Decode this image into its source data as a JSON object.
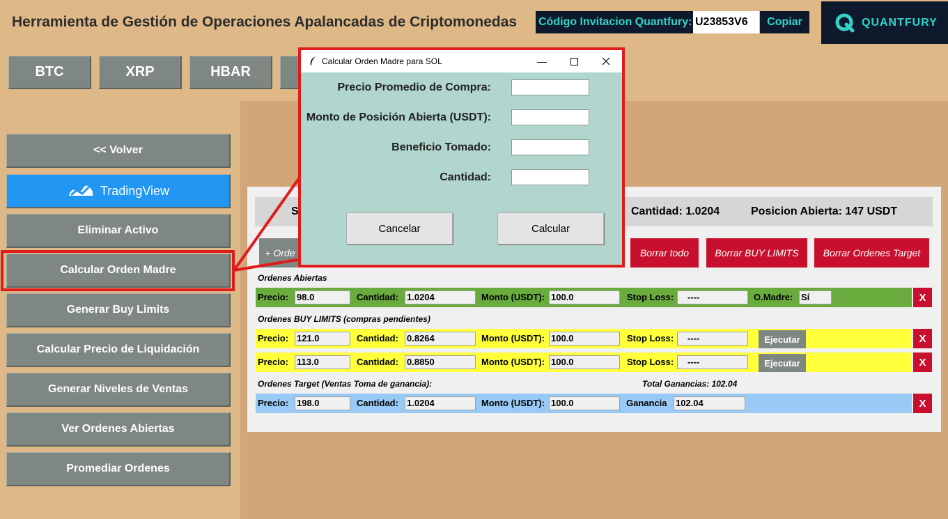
{
  "header": {
    "title": "Herramienta de Gestión de Operaciones Apalancadas de Criptomonedas",
    "invite_label": "Código Invitacion Quantfury:",
    "invite_code": "U23853V6",
    "copy_label": "Copiar",
    "brand": "QUANTFURY"
  },
  "assets": [
    "BTC",
    "XRP",
    "HBAR"
  ],
  "sidebar": {
    "back_label": "<<    Volver",
    "tradingview_label": "TradingView",
    "items": [
      "Eliminar Activo",
      "Calcular Orden Madre",
      "Generar Buy Limits",
      "Calcular Precio de Liquidación",
      "Generar Niveles de Ventas",
      "Ver Ordenes Abiertas",
      "Promediar Ordenes"
    ]
  },
  "summary": {
    "prefix": "S",
    "cantidad": "Cantidad: 1.0204",
    "posicion": "Posicion Abierta: 147 USDT"
  },
  "actions": {
    "add_label": "+ Orde",
    "borrar_todo": "Borrar todo",
    "borrar_buy_limits": "Borrar BUY LIMITS",
    "borrar_target": "Borrar Ordenes Target"
  },
  "labels": {
    "precio": "Precio:",
    "cantidad": "Cantidad:",
    "monto": "Monto (USDT):",
    "stop_loss": "Stop Loss:",
    "omadre": "O.Madre:",
    "ganancia": "Ganancia",
    "ejecutar": "Ejecutar",
    "delete": "X"
  },
  "open_orders": {
    "title": "Ordenes Abiertas",
    "rows": [
      {
        "precio": "98.0",
        "cantidad": "1.0204",
        "monto": "100.0",
        "stop_loss": "----",
        "omadre": "Sí"
      }
    ]
  },
  "buy_limits": {
    "title": "Ordenes BUY LIMITS (compras pendientes)",
    "rows": [
      {
        "precio": "121.0",
        "cantidad": "0.8264",
        "monto": "100.0",
        "stop_loss": "----"
      },
      {
        "precio": "113.0",
        "cantidad": "0.8850",
        "monto": "100.0",
        "stop_loss": "----"
      }
    ]
  },
  "targets": {
    "title": "Ordenes Target (Ventas Toma de ganancia):",
    "total": "Total Ganancias: 102.04",
    "rows": [
      {
        "precio": "198.0",
        "cantidad": "1.0204",
        "monto": "100.0",
        "ganancia": "102.04"
      }
    ]
  },
  "dialog": {
    "title": "Calcular Orden Madre para SOL",
    "fields": [
      {
        "label": "Precio Promedio de Compra:",
        "value": ""
      },
      {
        "label": "Monto de Posición Abierta (USDT):",
        "value": ""
      },
      {
        "label": "Beneficio Tomado:",
        "value": ""
      },
      {
        "label": "Cantidad:",
        "value": ""
      }
    ],
    "cancel_label": "Cancelar",
    "calc_label": "Calcular"
  },
  "colors": {
    "background": "#deb887",
    "accent_teal": "#32d3c8",
    "danger_red": "#c8102e",
    "highlight_red": "#e01b1b",
    "tradingview_blue": "#2196f3"
  }
}
